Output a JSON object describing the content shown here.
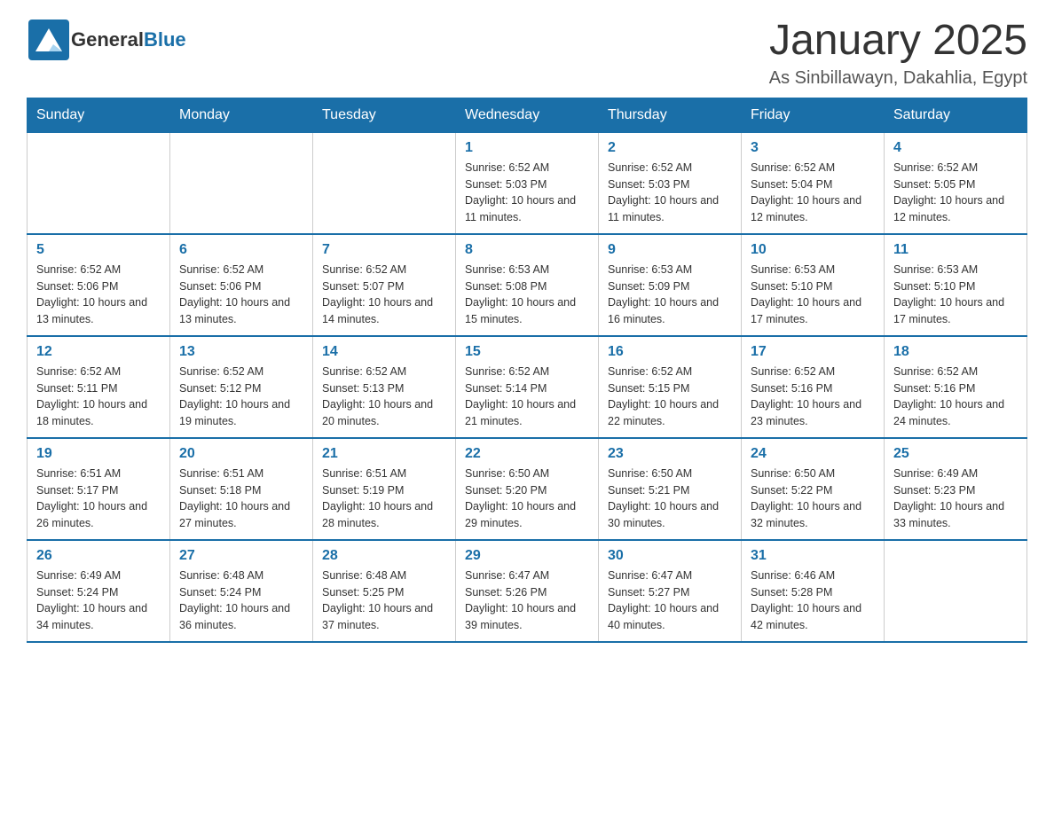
{
  "logo": {
    "general": "General",
    "blue": "Blue"
  },
  "title": "January 2025",
  "subtitle": "As Sinbillawayn, Dakahlia, Egypt",
  "days_of_week": [
    "Sunday",
    "Monday",
    "Tuesday",
    "Wednesday",
    "Thursday",
    "Friday",
    "Saturday"
  ],
  "weeks": [
    [
      {
        "day": "",
        "sunrise": "",
        "sunset": "",
        "daylight": ""
      },
      {
        "day": "",
        "sunrise": "",
        "sunset": "",
        "daylight": ""
      },
      {
        "day": "",
        "sunrise": "",
        "sunset": "",
        "daylight": ""
      },
      {
        "day": "1",
        "sunrise": "Sunrise: 6:52 AM",
        "sunset": "Sunset: 5:03 PM",
        "daylight": "Daylight: 10 hours and 11 minutes."
      },
      {
        "day": "2",
        "sunrise": "Sunrise: 6:52 AM",
        "sunset": "Sunset: 5:03 PM",
        "daylight": "Daylight: 10 hours and 11 minutes."
      },
      {
        "day": "3",
        "sunrise": "Sunrise: 6:52 AM",
        "sunset": "Sunset: 5:04 PM",
        "daylight": "Daylight: 10 hours and 12 minutes."
      },
      {
        "day": "4",
        "sunrise": "Sunrise: 6:52 AM",
        "sunset": "Sunset: 5:05 PM",
        "daylight": "Daylight: 10 hours and 12 minutes."
      }
    ],
    [
      {
        "day": "5",
        "sunrise": "Sunrise: 6:52 AM",
        "sunset": "Sunset: 5:06 PM",
        "daylight": "Daylight: 10 hours and 13 minutes."
      },
      {
        "day": "6",
        "sunrise": "Sunrise: 6:52 AM",
        "sunset": "Sunset: 5:06 PM",
        "daylight": "Daylight: 10 hours and 13 minutes."
      },
      {
        "day": "7",
        "sunrise": "Sunrise: 6:52 AM",
        "sunset": "Sunset: 5:07 PM",
        "daylight": "Daylight: 10 hours and 14 minutes."
      },
      {
        "day": "8",
        "sunrise": "Sunrise: 6:53 AM",
        "sunset": "Sunset: 5:08 PM",
        "daylight": "Daylight: 10 hours and 15 minutes."
      },
      {
        "day": "9",
        "sunrise": "Sunrise: 6:53 AM",
        "sunset": "Sunset: 5:09 PM",
        "daylight": "Daylight: 10 hours and 16 minutes."
      },
      {
        "day": "10",
        "sunrise": "Sunrise: 6:53 AM",
        "sunset": "Sunset: 5:10 PM",
        "daylight": "Daylight: 10 hours and 17 minutes."
      },
      {
        "day": "11",
        "sunrise": "Sunrise: 6:53 AM",
        "sunset": "Sunset: 5:10 PM",
        "daylight": "Daylight: 10 hours and 17 minutes."
      }
    ],
    [
      {
        "day": "12",
        "sunrise": "Sunrise: 6:52 AM",
        "sunset": "Sunset: 5:11 PM",
        "daylight": "Daylight: 10 hours and 18 minutes."
      },
      {
        "day": "13",
        "sunrise": "Sunrise: 6:52 AM",
        "sunset": "Sunset: 5:12 PM",
        "daylight": "Daylight: 10 hours and 19 minutes."
      },
      {
        "day": "14",
        "sunrise": "Sunrise: 6:52 AM",
        "sunset": "Sunset: 5:13 PM",
        "daylight": "Daylight: 10 hours and 20 minutes."
      },
      {
        "day": "15",
        "sunrise": "Sunrise: 6:52 AM",
        "sunset": "Sunset: 5:14 PM",
        "daylight": "Daylight: 10 hours and 21 minutes."
      },
      {
        "day": "16",
        "sunrise": "Sunrise: 6:52 AM",
        "sunset": "Sunset: 5:15 PM",
        "daylight": "Daylight: 10 hours and 22 minutes."
      },
      {
        "day": "17",
        "sunrise": "Sunrise: 6:52 AM",
        "sunset": "Sunset: 5:16 PM",
        "daylight": "Daylight: 10 hours and 23 minutes."
      },
      {
        "day": "18",
        "sunrise": "Sunrise: 6:52 AM",
        "sunset": "Sunset: 5:16 PM",
        "daylight": "Daylight: 10 hours and 24 minutes."
      }
    ],
    [
      {
        "day": "19",
        "sunrise": "Sunrise: 6:51 AM",
        "sunset": "Sunset: 5:17 PM",
        "daylight": "Daylight: 10 hours and 26 minutes."
      },
      {
        "day": "20",
        "sunrise": "Sunrise: 6:51 AM",
        "sunset": "Sunset: 5:18 PM",
        "daylight": "Daylight: 10 hours and 27 minutes."
      },
      {
        "day": "21",
        "sunrise": "Sunrise: 6:51 AM",
        "sunset": "Sunset: 5:19 PM",
        "daylight": "Daylight: 10 hours and 28 minutes."
      },
      {
        "day": "22",
        "sunrise": "Sunrise: 6:50 AM",
        "sunset": "Sunset: 5:20 PM",
        "daylight": "Daylight: 10 hours and 29 minutes."
      },
      {
        "day": "23",
        "sunrise": "Sunrise: 6:50 AM",
        "sunset": "Sunset: 5:21 PM",
        "daylight": "Daylight: 10 hours and 30 minutes."
      },
      {
        "day": "24",
        "sunrise": "Sunrise: 6:50 AM",
        "sunset": "Sunset: 5:22 PM",
        "daylight": "Daylight: 10 hours and 32 minutes."
      },
      {
        "day": "25",
        "sunrise": "Sunrise: 6:49 AM",
        "sunset": "Sunset: 5:23 PM",
        "daylight": "Daylight: 10 hours and 33 minutes."
      }
    ],
    [
      {
        "day": "26",
        "sunrise": "Sunrise: 6:49 AM",
        "sunset": "Sunset: 5:24 PM",
        "daylight": "Daylight: 10 hours and 34 minutes."
      },
      {
        "day": "27",
        "sunrise": "Sunrise: 6:48 AM",
        "sunset": "Sunset: 5:24 PM",
        "daylight": "Daylight: 10 hours and 36 minutes."
      },
      {
        "day": "28",
        "sunrise": "Sunrise: 6:48 AM",
        "sunset": "Sunset: 5:25 PM",
        "daylight": "Daylight: 10 hours and 37 minutes."
      },
      {
        "day": "29",
        "sunrise": "Sunrise: 6:47 AM",
        "sunset": "Sunset: 5:26 PM",
        "daylight": "Daylight: 10 hours and 39 minutes."
      },
      {
        "day": "30",
        "sunrise": "Sunrise: 6:47 AM",
        "sunset": "Sunset: 5:27 PM",
        "daylight": "Daylight: 10 hours and 40 minutes."
      },
      {
        "day": "31",
        "sunrise": "Sunrise: 6:46 AM",
        "sunset": "Sunset: 5:28 PM",
        "daylight": "Daylight: 10 hours and 42 minutes."
      },
      {
        "day": "",
        "sunrise": "",
        "sunset": "",
        "daylight": ""
      }
    ]
  ]
}
